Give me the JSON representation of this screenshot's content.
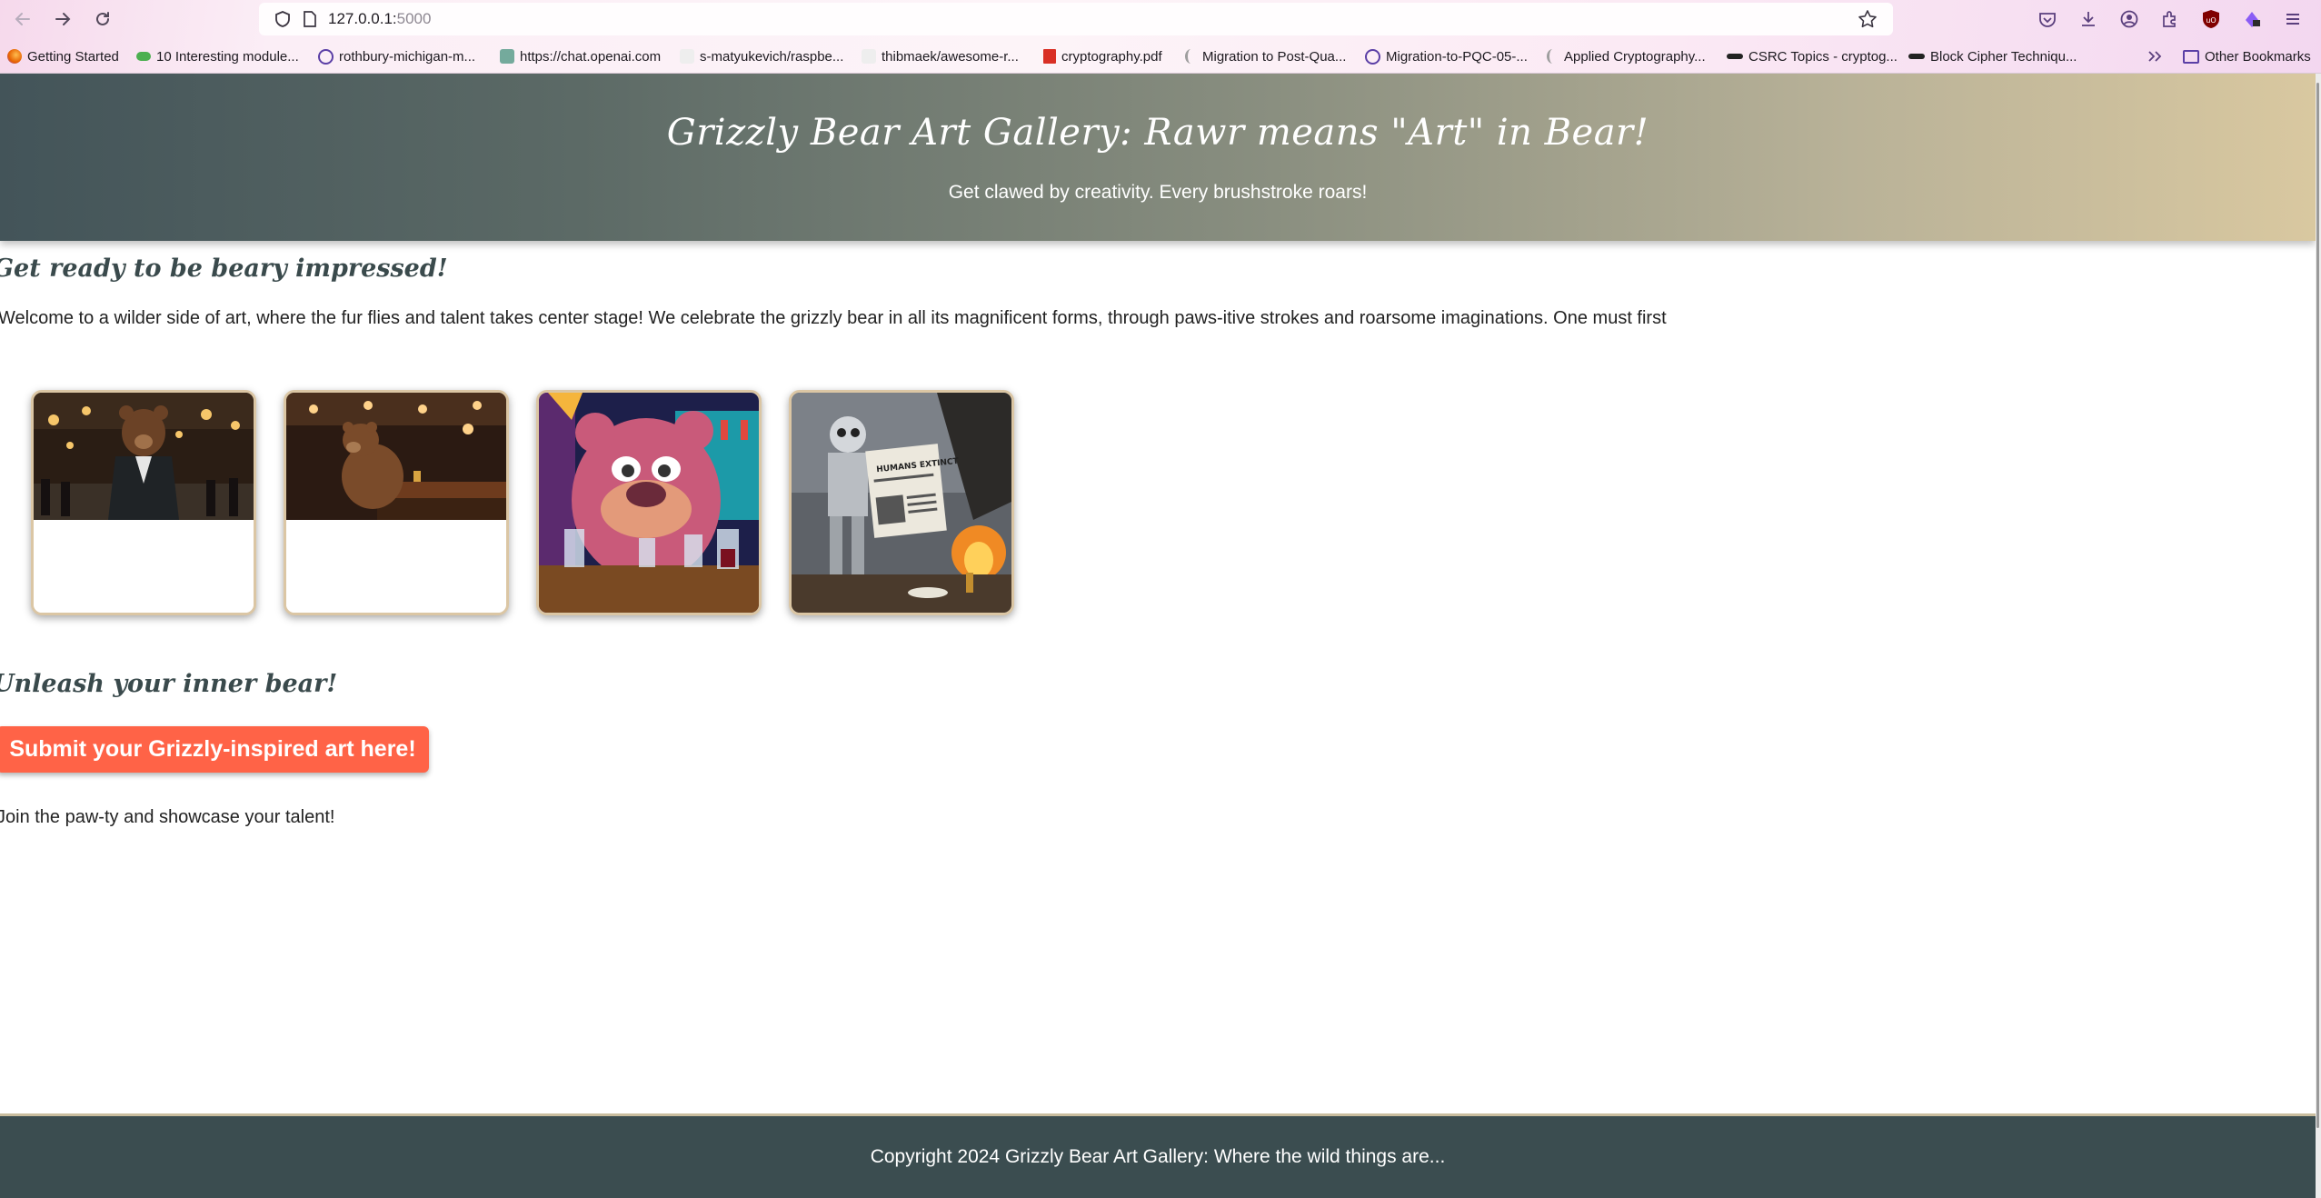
{
  "browser": {
    "url_host": "127.0.0.1:",
    "url_port": "5000",
    "bookmarks": [
      {
        "label": "Getting Started",
        "icon": "firefox-icon",
        "color": "#e66000"
      },
      {
        "label": "10 Interesting module...",
        "icon": "module-icon",
        "color": "#4caf50"
      },
      {
        "label": "rothbury-michigan-m...",
        "icon": "globe-icon",
        "color": "#5b3fa6"
      },
      {
        "label": "https://chat.openai.com",
        "icon": "openai-icon",
        "color": "#74aa9c"
      },
      {
        "label": "s-matyukevich/raspbe...",
        "icon": "page-icon",
        "color": "#dddddd"
      },
      {
        "label": "thibmaek/awesome-r...",
        "icon": "page-icon",
        "color": "#dddddd"
      },
      {
        "label": "cryptography.pdf",
        "icon": "pdf-icon",
        "color": "#d93025"
      },
      {
        "label": "Migration to Post-Qua...",
        "icon": "crescent-icon",
        "color": "#9e9e9e"
      },
      {
        "label": "Migration-to-PQC-05-...",
        "icon": "globe-icon",
        "color": "#5b3fa6"
      },
      {
        "label": "Applied Cryptography...",
        "icon": "crescent-icon",
        "color": "#9e9e9e"
      },
      {
        "label": "CSRC Topics - cryptog...",
        "icon": "nist-icon",
        "color": "#222222"
      },
      {
        "label": "Block Cipher Techniqu...",
        "icon": "nist-icon",
        "color": "#222222"
      },
      {
        "label": "Other Bookmarks",
        "icon": "folder-icon",
        "color": "#5b3fa6"
      }
    ]
  },
  "header": {
    "title": "Grizzly Bear Art Gallery: Rawr means \"Art\" in Bear!",
    "tagline": "Get clawed by creativity. Every brushstroke roars!"
  },
  "intro": {
    "heading": "Get ready to be beary impressed!",
    "text": "Welcome to a wilder side of art, where the fur flies and talent takes center stage! We celebrate the grizzly bear in all its magnificent forms, through paws-itive strokes and roarsome imaginations. One must first"
  },
  "gallery": [
    {
      "subject": "bear in suit standing in bar"
    },
    {
      "subject": "bear sitting at bar counter"
    },
    {
      "subject": "cartoon pink bear with drinks at bar"
    },
    {
      "subject": "robot reading newspaper amid ruins"
    }
  ],
  "gallery_newspaper_text": "HUMANS EXTINCT",
  "submit_section": {
    "heading": "Unleash your inner bear!",
    "button_label": "Submit your Grizzly-inspired art here!",
    "join_text": "Join the paw-ty and showcase your talent!"
  },
  "footer": {
    "text": "Copyright 2024 Grizzly Bear Art Gallery: Where the wild things are..."
  },
  "colors": {
    "header_gradient_start": "#435459",
    "header_gradient_end": "#d9c8a0",
    "button": "#ff6347",
    "footer": "#3b4d50",
    "card_border": "#dbc6a4"
  }
}
